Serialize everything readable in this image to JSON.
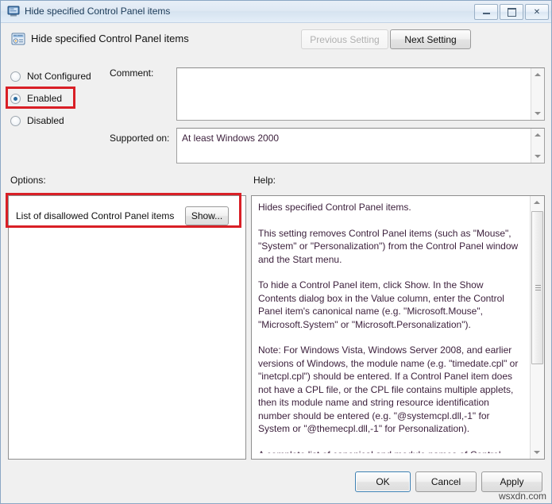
{
  "window": {
    "title": "Hide specified Control Panel items",
    "title_icon": "control-panel-icon",
    "minimize_label": "Minimize",
    "maximize_label": "Maximize",
    "close_label": "✕"
  },
  "header": {
    "title": "Hide specified Control Panel items",
    "icon": "policy-setting-icon",
    "previous_setting": "Previous Setting",
    "next_setting": "Next Setting"
  },
  "state_options": [
    {
      "label": "Not Configured",
      "selected": false
    },
    {
      "label": "Enabled",
      "selected": true
    },
    {
      "label": "Disabled",
      "selected": false
    }
  ],
  "fields": {
    "comment_label": "Comment:",
    "comment_value": "",
    "supported_label": "Supported on:",
    "supported_value": "At least Windows 2000"
  },
  "options": {
    "label": "Options:",
    "row_label": "List of disallowed Control Panel items",
    "show_button": "Show..."
  },
  "help": {
    "label": "Help:",
    "text": "Hides specified Control Panel items.\n\nThis setting removes Control Panel items (such as \"Mouse\", \"System\" or \"Personalization\") from the Control Panel window and the Start menu.\n\nTo hide a Control Panel item, click Show. In the Show Contents dialog box in the Value column, enter the Control Panel item's canonical name (e.g. \"Microsoft.Mouse\", \"Microsoft.System\" or \"Microsoft.Personalization\").\n\nNote: For Windows Vista, Windows Server 2008, and earlier versions of Windows, the module name (e.g. \"timedate.cpl\" or \"inetcpl.cpl\") should be entered. If a Control Panel item does not have a CPL file, or the CPL file contains multiple applets, then its module name and string resource identification number should be entered (e.g. \"@systemcpl.dll,-1\" for System or \"@themecpl.dll,-1\" for Personalization).\n\nA complete list of canonical and module names of Control Panel items can be found in MSDN at"
  },
  "footer": {
    "ok": "OK",
    "cancel": "Cancel",
    "apply": "Apply"
  },
  "watermark": "wsxdn.com",
  "colors": {
    "highlight": "#d91f26",
    "titlebar_text": "#1b3a57",
    "help_text": "#3b1f3b"
  }
}
